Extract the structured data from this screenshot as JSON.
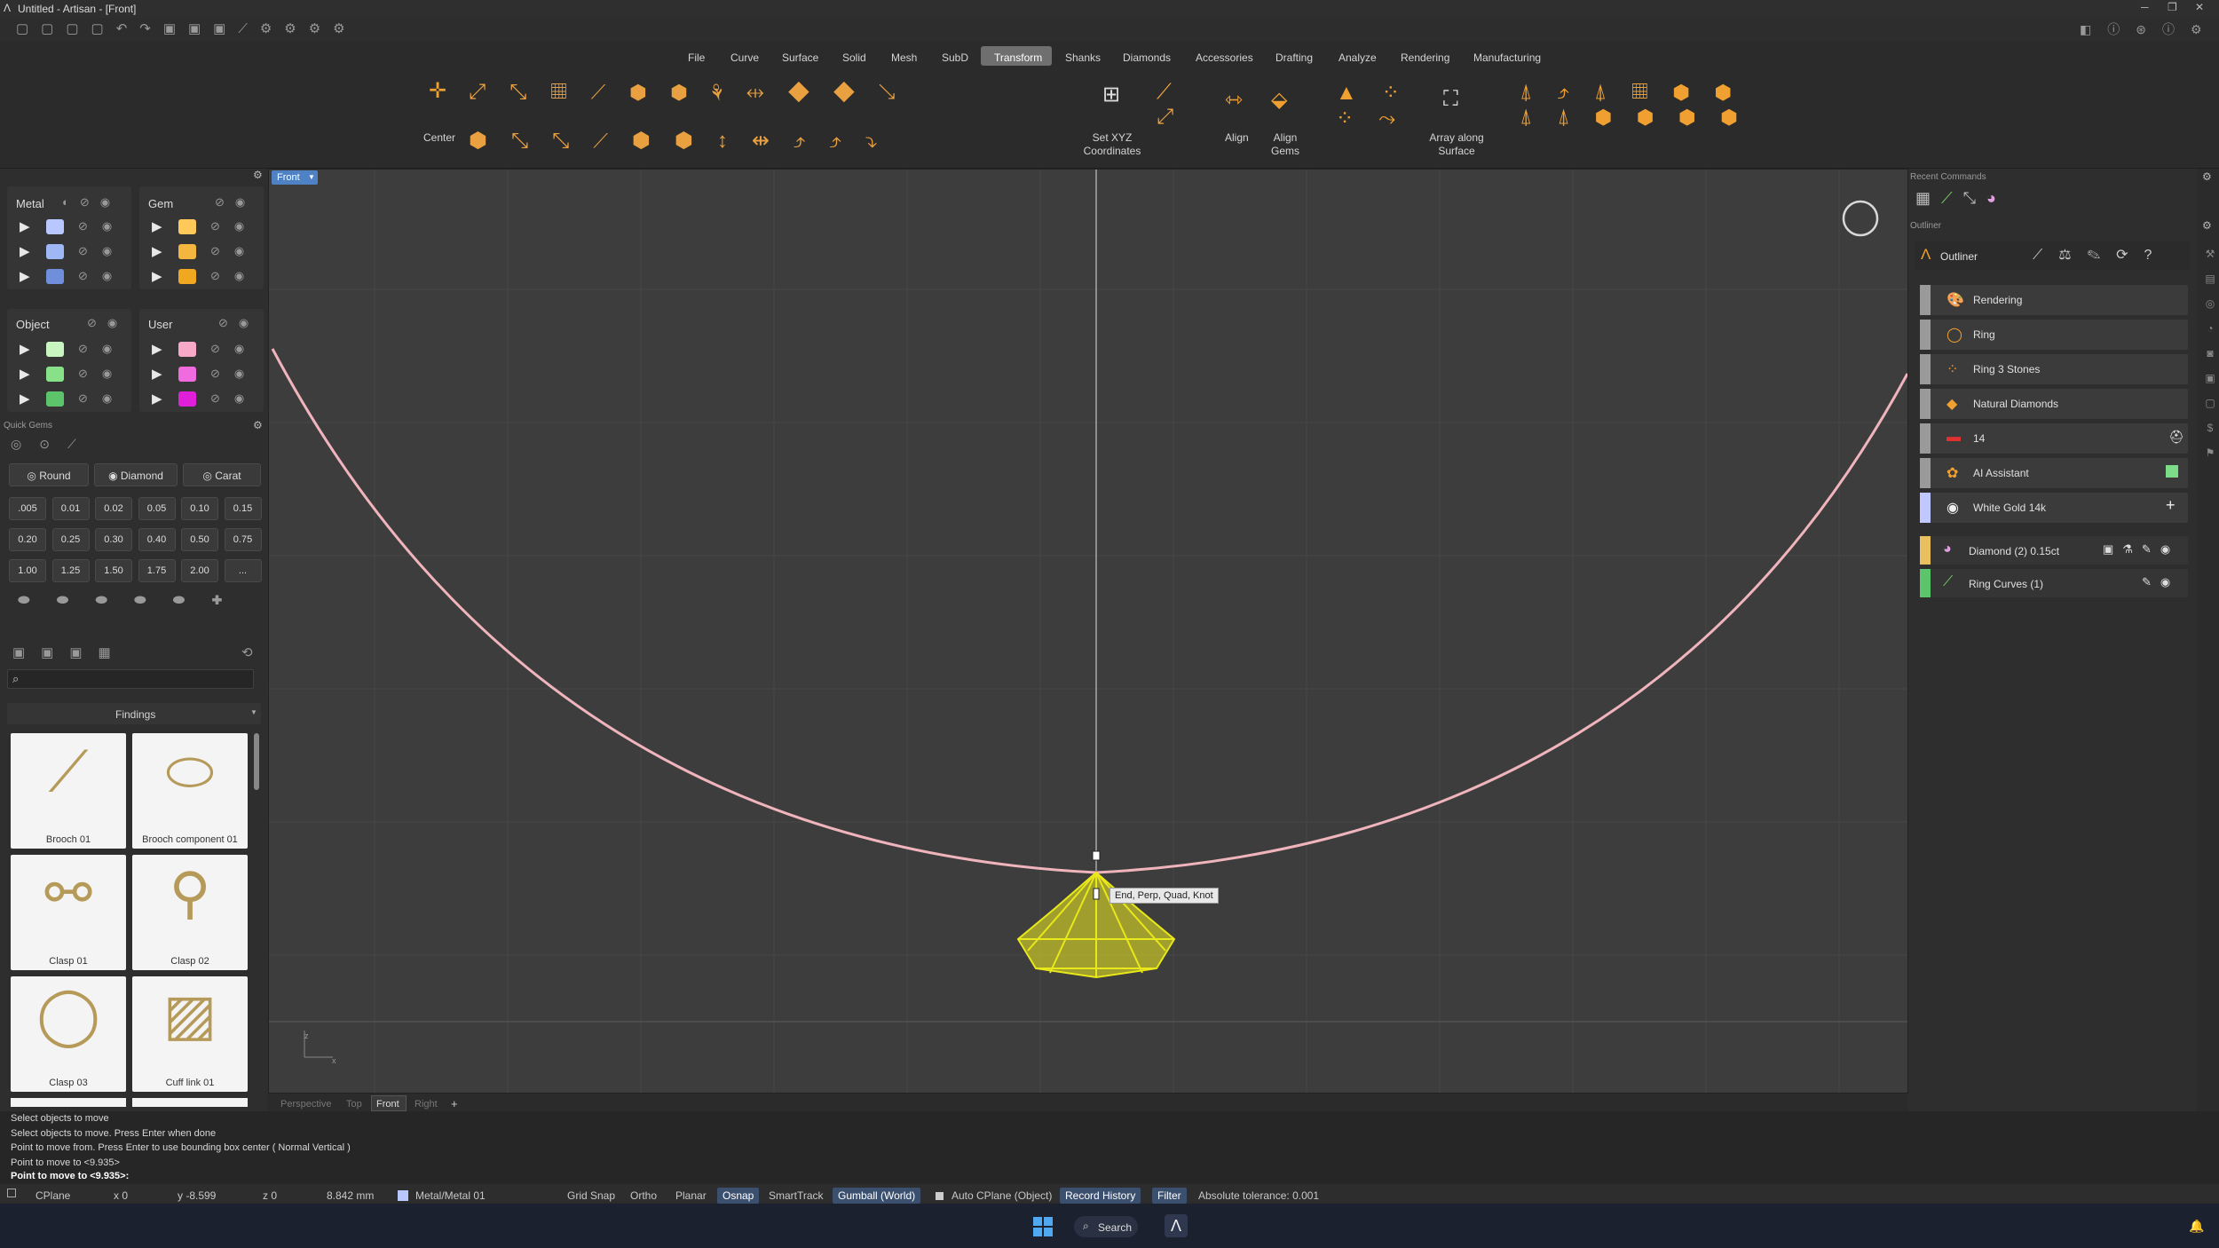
{
  "window": {
    "title": "Untitled - Artisan - [Front]"
  },
  "menu": [
    "File",
    "Curve",
    "Surface",
    "Solid",
    "Mesh",
    "SubD",
    "Transform",
    "Shanks",
    "Diamonds",
    "Accessories",
    "Drafting",
    "Analyze",
    "Rendering",
    "Manufacturing"
  ],
  "toolbar": {
    "center": "Center",
    "set_xyz": "Set XYZ\nCoordinates",
    "align": "Align",
    "align_gems": "Align\nGems",
    "array_surface": "Array along\nSurface"
  },
  "viewport": {
    "name": "Front",
    "tooltip": "End, Perp, Quad, Knot",
    "tabs": [
      "Perspective",
      "Top",
      "Front",
      "Right"
    ],
    "add": "+"
  },
  "layers": {
    "metal": "Metal",
    "gem": "Gem",
    "object": "Object",
    "user": "User",
    "metal_colors": [
      "#b8c8ff",
      "#9fb8f5",
      "#6f8fdc"
    ],
    "gem_colors": [
      "#ffc95a",
      "#f5b640",
      "#f0a820"
    ],
    "object_colors": [
      "#c8f5c0",
      "#88e088",
      "#5cc46a"
    ],
    "user_colors": [
      "#f8a9c8",
      "#f06ae0",
      "#e020d8"
    ]
  },
  "quick_gems": {
    "title": "Quick Gems",
    "shape": "Round",
    "type": "Diamond",
    "unit": "Carat",
    "sizes": [
      ".005",
      "0.01",
      "0.02",
      "0.05",
      "0.10",
      "0.15",
      "0.20",
      "0.25",
      "0.30",
      "0.40",
      "0.50",
      "0.75",
      "1.00",
      "1.25",
      "1.50",
      "1.75",
      "2.00",
      "..."
    ]
  },
  "library": {
    "search_placeholder": "",
    "category": "Findings",
    "items": [
      "Brooch 01",
      "Brooch component 01",
      "Clasp 01",
      "Clasp 02",
      "Clasp 03",
      "Cuff link 01"
    ]
  },
  "right": {
    "recent_commands": "Recent Commands",
    "outliner_section": "Outliner",
    "outliner_title": "Outliner",
    "rows": [
      "Rendering",
      "Ring",
      "Ring 3 Stones",
      "Natural Diamonds",
      "14",
      "AI Assistant",
      "White Gold 14k"
    ],
    "objects": [
      {
        "label": "Diamond (2) 0.15ct",
        "color": "#e8c060"
      },
      {
        "label": "Ring Curves (1)",
        "color": "#5cc46a"
      }
    ]
  },
  "command_history": [
    "Select objects to move",
    "Select objects to move. Press Enter when done",
    "Point to move from. Press Enter to use bounding box center ( Normal  Vertical )",
    "Point to move to <9.935>"
  ],
  "command_prompt": "Point to move to <9.935>:",
  "status": {
    "cplane": "CPlane",
    "x": "x 0",
    "y": "y -8.599",
    "z": "z 0",
    "dist": "8.842 mm",
    "layer": "Metal/Metal 01",
    "grid_snap": "Grid Snap",
    "ortho": "Ortho",
    "planar": "Planar",
    "osnap": "Osnap",
    "smarttrack": "SmartTrack",
    "gumball": "Gumball (World)",
    "auto_cplane": "Auto CPlane (Object)",
    "record_history": "Record History",
    "filter": "Filter",
    "tolerance": "Absolute tolerance: 0.001"
  },
  "taskbar": {
    "search": "Search"
  },
  "colors": {
    "accent": "#4f82c4",
    "curve": "#f0b4bc",
    "gem": "#f2f020"
  }
}
